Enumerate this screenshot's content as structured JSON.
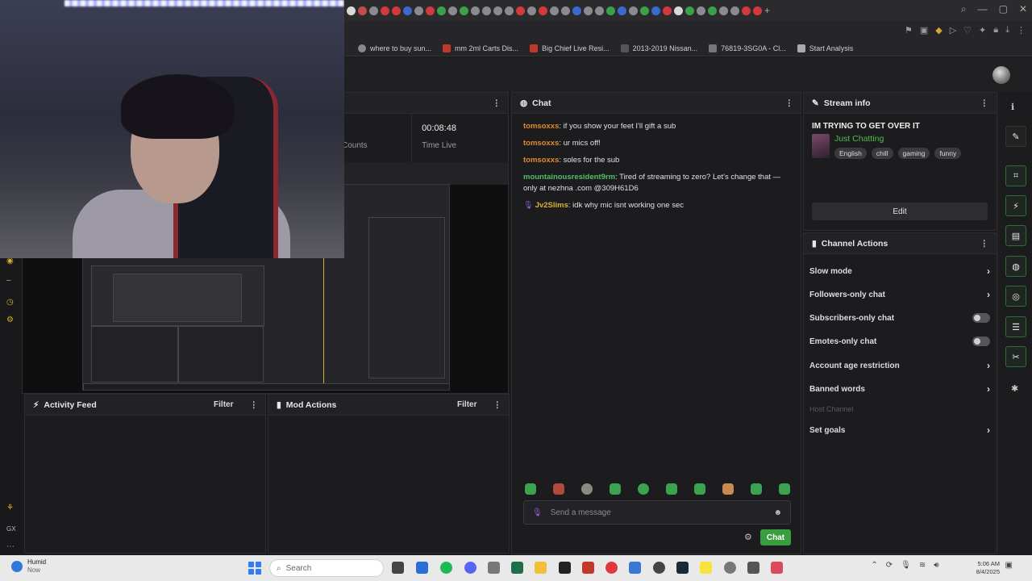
{
  "bookmarks": [
    {
      "label": "where to buy sun..."
    },
    {
      "label": "mm 2ml Carts Dis..."
    },
    {
      "label": "Big Chief Live Resi..."
    },
    {
      "label": "2013-2019 Nissan..."
    },
    {
      "label": "76819-3SG0A - Cl..."
    },
    {
      "label": "Start Analysis"
    }
  ],
  "stats": {
    "counts_label": "Counts",
    "time_value": "00:08:48",
    "time_label": "Time Live"
  },
  "chat": {
    "title": "Chat",
    "messages": [
      {
        "user": "tomsoxxs",
        "text": ": if you show your feet I'll gift a sub",
        "color": "#e08a2e"
      },
      {
        "user": "tomsoxxs",
        "text": ": ur mics off!",
        "color": "#e08a2e"
      },
      {
        "user": "tomsoxxs",
        "text": ": soles for the sub",
        "color": "#e08a2e"
      },
      {
        "user": "mountainousresident9rm",
        "text": ": Tired of streaming to zero? Let's change that — only at nezhna .com @309H61D6",
        "color": "#4fbf6a"
      },
      {
        "user": "Jv2Slims",
        "text": ": idk why mic isnt working one sec",
        "color": "#d9b23a"
      }
    ],
    "input_placeholder": "Send a message",
    "send_label": "Chat"
  },
  "activity_feed": {
    "title": "Activity Feed",
    "filter_label": "Filter"
  },
  "mod_actions": {
    "title": "Mod Actions",
    "filter_label": "Filter"
  },
  "stream_info": {
    "title": "Stream info",
    "stream_title": "IM TRYING TO GET OVER IT",
    "category": "Just Chatting",
    "tags": [
      "English",
      "chill",
      "gaming",
      "funny"
    ],
    "edit_label": "Edit"
  },
  "channel_actions": {
    "title": "Channel Actions",
    "items": {
      "slow_mode": "Slow mode",
      "followers_only": "Followers-only chat",
      "subscribers_only": "Subscribers-only chat",
      "emotes_only": "Emotes-only chat",
      "account_age": "Account age restriction",
      "banned_words": "Banned words",
      "host_channel": "Host Channel",
      "set_goals": "Set goals"
    },
    "subscribers_only_enabled": false,
    "emotes_only_enabled": false
  },
  "taskbar": {
    "weather_label": "Humid",
    "weather_sub": "Now",
    "search_placeholder": "Search",
    "time": "5:06 AM",
    "date": "8/4/2025"
  },
  "colors": {
    "accent_green": "#3a9e40",
    "category_green": "#4fbf4a"
  }
}
